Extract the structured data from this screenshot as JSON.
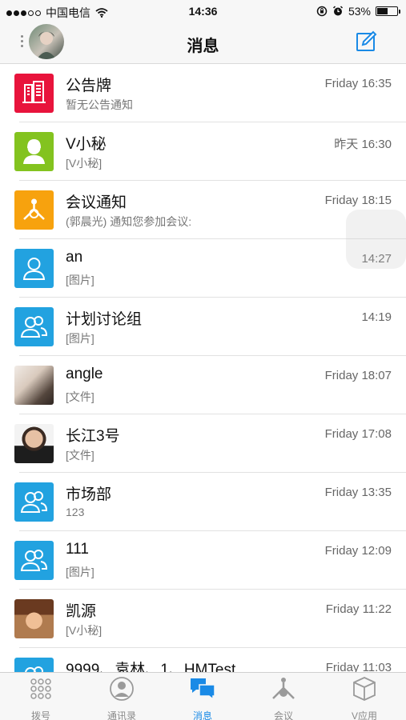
{
  "status_bar": {
    "carrier": "中国电信",
    "time": "14:36",
    "battery_percent": "53%",
    "battery_level": 0.53,
    "icons": [
      "signal-dots-icon",
      "wifi-icon",
      "orientation-lock-icon",
      "alarm-icon",
      "battery-icon"
    ]
  },
  "nav": {
    "title": "消息",
    "icons": [
      "more-dots-icon",
      "compose-icon"
    ]
  },
  "conversations": [
    {
      "name": "公告牌",
      "preview": "暂无公告通知",
      "time": "Friday 16:35",
      "avatar": "bulletin-board-icon",
      "color": "#e8143c"
    },
    {
      "name": "V小秘",
      "preview": "[V小秘]",
      "time": "昨天 16:30",
      "avatar": "assistant-icon",
      "color": "#83c31f"
    },
    {
      "name": "会议通知",
      "preview": "(郭晨光) 通知您参加会议:",
      "time": "Friday 18:15",
      "avatar": "meeting-icon",
      "color": "#f7a20e"
    },
    {
      "name": "an",
      "preview": "[图片]",
      "time": "14:27",
      "avatar": "person-icon",
      "color": "#22a2e0"
    },
    {
      "name": "计划讨论组",
      "preview": "[图片]",
      "time": "14:19",
      "avatar": "group-icon",
      "color": "#22a2e0"
    },
    {
      "name": "angle",
      "preview": "[文件]",
      "time": "Friday 18:07",
      "avatar": "photo-avatar",
      "color": ""
    },
    {
      "name": "长江3号",
      "preview": "[文件]",
      "time": "Friday 17:08",
      "avatar": "photo-avatar",
      "color": ""
    },
    {
      "name": "市场部",
      "preview": "123",
      "time": "Friday 13:35",
      "avatar": "group-icon",
      "color": "#22a2e0"
    },
    {
      "name": "111",
      "preview": "[图片]",
      "time": "Friday 12:09",
      "avatar": "group-icon",
      "color": "#22a2e0"
    },
    {
      "name": "凯源",
      "preview": "[V小秘]",
      "time": "Friday 11:22",
      "avatar": "photo-avatar",
      "color": ""
    },
    {
      "name": "9999、袁林、1、HMTest",
      "preview": "",
      "time": "Friday 11:03",
      "avatar": "group-icon",
      "color": "#22a2e0"
    }
  ],
  "tabs": [
    {
      "label": "拨号",
      "icon": "dialpad-icon",
      "active": false
    },
    {
      "label": "通讯录",
      "icon": "contacts-icon",
      "active": false
    },
    {
      "label": "消息",
      "icon": "messages-icon",
      "active": true
    },
    {
      "label": "会议",
      "icon": "meeting-icon",
      "active": false
    },
    {
      "label": "V应用",
      "icon": "apps-box-icon",
      "active": false
    }
  ],
  "colors": {
    "accent": "#1a8ae6",
    "inactive": "#8a8a8a"
  }
}
